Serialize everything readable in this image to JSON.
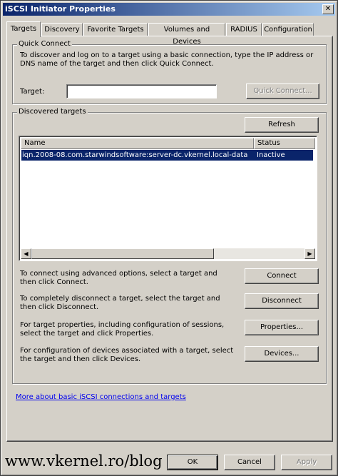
{
  "window": {
    "title": "iSCSI Initiator Properties",
    "close_glyph": "✕"
  },
  "tabs": [
    {
      "label": "Targets"
    },
    {
      "label": "Discovery"
    },
    {
      "label": "Favorite Targets"
    },
    {
      "label": "Volumes and Devices"
    },
    {
      "label": "RADIUS"
    },
    {
      "label": "Configuration"
    }
  ],
  "quick_connect": {
    "title": "Quick Connect",
    "description": "To discover and log on to a target using a basic connection, type the IP address or DNS name of the target and then click Quick Connect.",
    "target_label": "Target:",
    "target_value": "",
    "button": "Quick Connect..."
  },
  "discovered": {
    "title": "Discovered targets",
    "refresh_button": "Refresh",
    "columns": [
      "Name",
      "Status"
    ],
    "rows": [
      {
        "name": "iqn.2008-08.com.starwindsoftware:server-dc.vkernel.local-data",
        "status": "Inactive"
      }
    ],
    "scroll_left": "◀",
    "scroll_right": "▶"
  },
  "actions": [
    {
      "text": "To connect using advanced options, select a target and then click Connect.",
      "button": "Connect"
    },
    {
      "text": "To completely disconnect a target, select the target and then click Disconnect.",
      "button": "Disconnect"
    },
    {
      "text": "For target properties, including configuration of sessions, select the target and click Properties.",
      "button": "Properties..."
    },
    {
      "text": "For configuration of devices associated with a target, select the target and then click Devices.",
      "button": "Devices..."
    }
  ],
  "link": "More about basic iSCSI connections and targets",
  "footer": {
    "ok": "OK",
    "cancel": "Cancel",
    "apply": "Apply"
  },
  "watermark": "www.vkernel.ro/blog"
}
